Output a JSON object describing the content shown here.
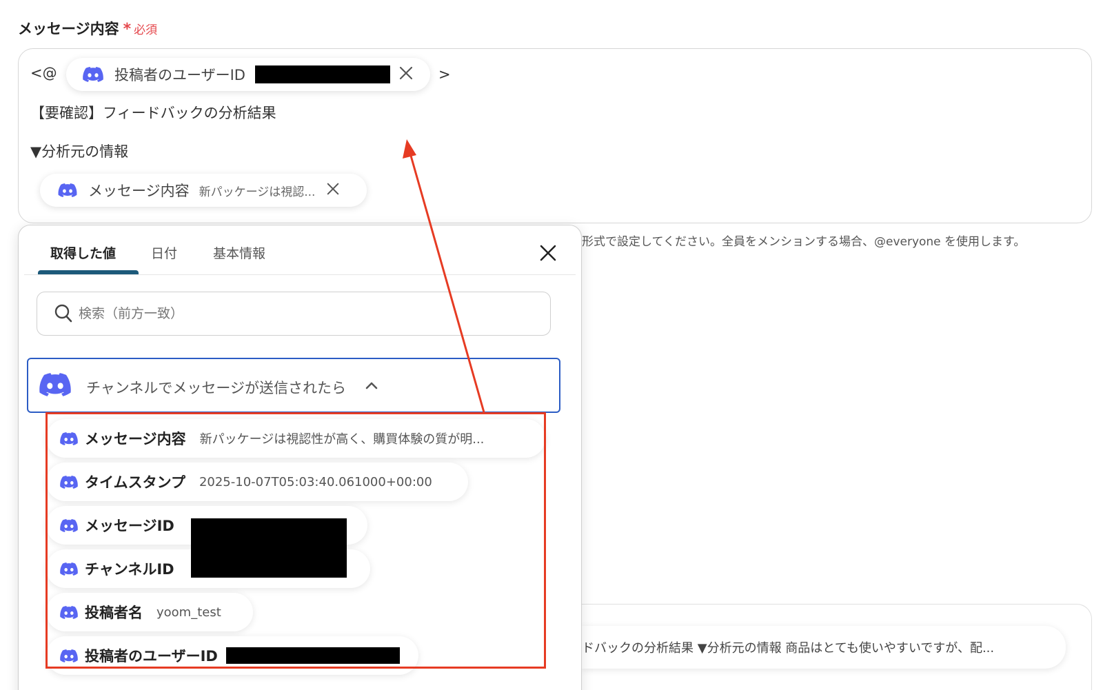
{
  "field": {
    "label": "メッセージ内容",
    "required_mark": "*",
    "required_text": "必須"
  },
  "editor": {
    "prefix": "<@",
    "suffix": ">",
    "user_chip_label": "投稿者のユーザーID",
    "line1": "【要確認】フィードバックの分析結果",
    "line2": "▼分析元の情報",
    "message_chip_label": "メッセージ内容",
    "message_chip_value": "新パッケージは視認..."
  },
  "helper_text": "形式で設定してください。全員をメンションする場合、@everyone を使用します。",
  "preview_text": "ドバックの分析結果 ▼分析元の情報 商品はとても使いやすいですが、配...",
  "panel": {
    "tabs": [
      {
        "label": "取得した値"
      },
      {
        "label": "日付"
      },
      {
        "label": "基本情報"
      }
    ],
    "search_placeholder": "検索（前方一致）",
    "section_title": "チャンネルでメッセージが送信されたら",
    "items": [
      {
        "name": "メッセージ内容",
        "value": "新パッケージは視認性が高く、購買体験の質が明..."
      },
      {
        "name": "タイムスタンプ",
        "value": "2025-10-07T05:03:40.061000+00:00"
      },
      {
        "name": "メッセージID",
        "value": ""
      },
      {
        "name": "チャンネルID",
        "value": ""
      },
      {
        "name": "投稿者名",
        "value": "yoom_test"
      },
      {
        "name": "投稿者のユーザーID",
        "value": ""
      }
    ]
  },
  "colors": {
    "accent_tab": "#1d5a7a",
    "section_border": "#2b5cc4",
    "highlight": "#e63b23",
    "discord": "#5865f2",
    "required": "#e5484d"
  },
  "icons": [
    "discord-icon",
    "close-icon",
    "search-icon",
    "chevron-up-icon"
  ]
}
